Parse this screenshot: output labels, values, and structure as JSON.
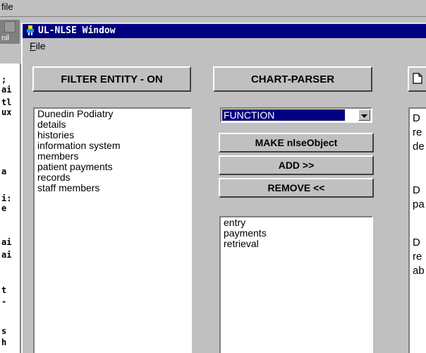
{
  "background_app": {
    "menu": {
      "file_label": "file"
    },
    "tab_label": "nil",
    "text_fragments": [
      ";",
      "ai",
      "tl",
      "ux",
      "a",
      "i:",
      "e",
      "ai",
      "ai",
      "t",
      "-",
      "s",
      "h"
    ]
  },
  "window": {
    "title": "UL-NLSE Window",
    "menu": {
      "file_label_mnemonic": "F",
      "file_label_rest": "ile"
    }
  },
  "toolbar": {
    "filter_label": "FILTER ENTITY - ON",
    "chart_label": "CHART-PARSER"
  },
  "entities": [
    "Dunedin Podiatry",
    "details",
    "histories",
    "information system",
    "members",
    "patient payments",
    "records",
    "staff members"
  ],
  "function_select": {
    "value": "FUNCTION"
  },
  "actions": {
    "make_label": "MAKE nlseObject",
    "add_label": "ADD >>",
    "remove_label": "REMOVE <<"
  },
  "slots": [
    "entry",
    "payments",
    "retrieval"
  ],
  "description": {
    "paragraphs": [
      {
        "lines": [
          "D",
          "re",
          "de"
        ]
      },
      {
        "lines": [
          "D",
          "pa"
        ]
      },
      {
        "lines": [
          "D",
          "re",
          "ab"
        ]
      }
    ]
  },
  "icons": {
    "title_icon": "app-icon",
    "combo_arrow": "chevron-down-icon",
    "doc_button_icon": "document-icon"
  }
}
